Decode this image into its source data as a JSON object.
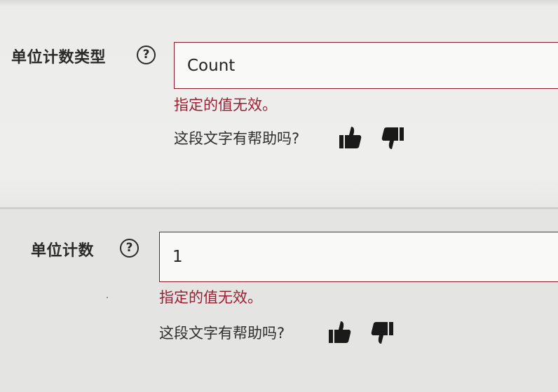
{
  "fields": [
    {
      "label": "单位计数类型",
      "help_glyph": "?",
      "value": "Count",
      "error": "指定的值无效。",
      "feedback_prompt": "这段文字有帮助吗?",
      "icons": [
        "question-circle-icon",
        "thumbs-up-icon",
        "thumbs-down-icon"
      ]
    },
    {
      "label": "单位计数",
      "help_glyph": "?",
      "value": "1",
      "error": "指定的值无效。",
      "feedback_prompt": "这段文字有帮助吗?",
      "icons": [
        "question-circle-icon",
        "thumbs-up-icon",
        "thumbs-down-icon"
      ]
    }
  ],
  "colors": {
    "error_text": "#9a1f33",
    "input_border_invalid": "#8a1a2a",
    "background": "#ececea"
  }
}
